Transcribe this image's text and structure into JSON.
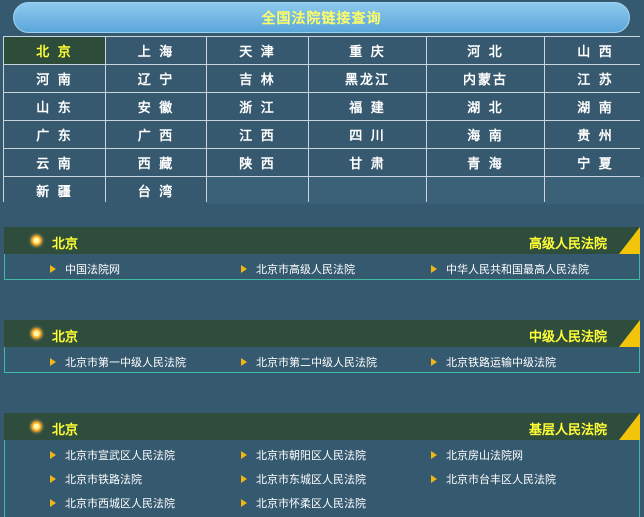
{
  "header": {
    "title": "全国法院链接查询"
  },
  "provinces": [
    "北 京",
    "上 海",
    "天 津",
    "重 庆",
    "河 北",
    "山 西",
    "河 南",
    "辽 宁",
    "吉 林",
    "黑龙江",
    "内蒙古",
    "江 苏",
    "山 东",
    "安 徽",
    "浙 江",
    "福 建",
    "湖 北",
    "湖 南",
    "广 东",
    "广 西",
    "江 西",
    "四 川",
    "海 南",
    "贵 州",
    "云 南",
    "西 藏",
    "陕 西",
    "甘 肃",
    "青 海",
    "宁 夏",
    "新 疆",
    "台 湾"
  ],
  "active_province": "北 京",
  "sections": [
    {
      "city": "北京",
      "level": "高级人民法院",
      "links": [
        "中国法院网",
        "北京市高级人民法院",
        "中华人民共和国最高人民法院"
      ]
    },
    {
      "city": "北京",
      "level": "中级人民法院",
      "links": [
        "北京市第一中级人民法院",
        "北京市第二中级人民法院",
        "北京铁路运输中级法院"
      ]
    },
    {
      "city": "北京",
      "level": "基层人民法院",
      "links": [
        "北京市宣武区人民法院",
        "北京市朝阳区人民法院",
        "北京房山法院网",
        "北京市铁路法院",
        "北京市东城区人民法院",
        "北京市台丰区人民法院",
        "北京市西城区人民法院",
        "北京市怀柔区人民法院"
      ]
    }
  ],
  "colors": {
    "background": "#35596f",
    "accent_text": "#ffff33",
    "section_header": "#2f4d3d",
    "corner": "#f2c40a",
    "arrow": "#f2b614"
  },
  "icons": {
    "section_bullet": "orange-dot-icon",
    "link_bullet": "triangle-arrow-icon"
  }
}
